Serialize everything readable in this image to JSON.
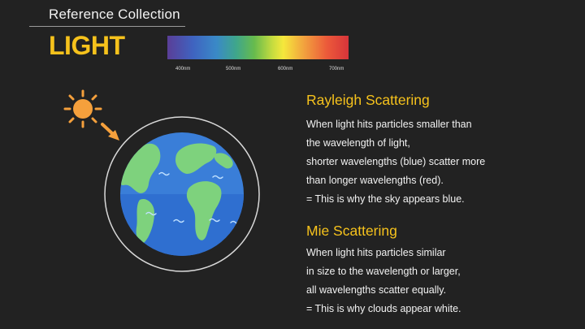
{
  "header": {
    "collection_title": "Reference Collection",
    "topic_title": "LIGHT"
  },
  "spectrum": {
    "ticks": [
      "400nm",
      "500nm",
      "600nm",
      "700nm"
    ]
  },
  "rayleigh": {
    "heading": "Rayleigh Scattering",
    "lines": [
      "When light hits particles smaller than",
      "the wavelength of light,",
      "shorter wavelengths (blue) scatter more",
      "than longer wavelengths (red).",
      "= This is why the sky appears blue."
    ]
  },
  "mie": {
    "heading": "Mie Scattering",
    "lines": [
      "When light hits particles similar",
      "in size to the wavelength or larger,",
      "all wavelengths scatter equally.",
      "= This is why clouds appear white."
    ]
  },
  "illustration": {
    "icons": [
      "sun-icon",
      "arrow-icon",
      "earth-icon"
    ],
    "colors": {
      "accent": "#f6c21c",
      "sun": "#f5a03c",
      "ocean": "#3a7ed8",
      "land": "#7ed27d"
    }
  }
}
